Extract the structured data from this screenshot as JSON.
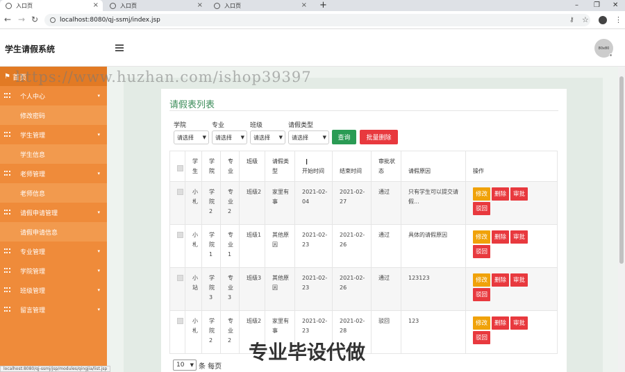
{
  "browser": {
    "tabs": [
      {
        "title": "入口页"
      },
      {
        "title": "入口页"
      },
      {
        "title": "入口页"
      }
    ],
    "url": "localhost:8080/qj-ssmj/index.jsp",
    "status_url": "localhost:8080/qj-ssmj/jsp/modules/qingjia/list.jsp"
  },
  "header": {
    "app_title": "学生请假系统",
    "avatar_text": "80x80"
  },
  "sidebar": {
    "top_label": "首页",
    "items": [
      {
        "type": "group",
        "label": "个人中心"
      },
      {
        "type": "sub",
        "label": "修改密码"
      },
      {
        "type": "group",
        "label": "学生管理"
      },
      {
        "type": "sub",
        "label": "学生信息"
      },
      {
        "type": "group",
        "label": "老师管理"
      },
      {
        "type": "sub",
        "label": "老师信息"
      },
      {
        "type": "group",
        "label": "请假申请管理"
      },
      {
        "type": "sub",
        "label": "请假申请信息"
      },
      {
        "type": "group",
        "label": "专业管理"
      },
      {
        "type": "group",
        "label": "学院管理"
      },
      {
        "type": "group",
        "label": "班级管理"
      },
      {
        "type": "group",
        "label": "留言管理"
      }
    ]
  },
  "main": {
    "title": "请假表列表",
    "filters": [
      {
        "label": "学院",
        "value": "请选择"
      },
      {
        "label": "专业",
        "value": "请选择"
      },
      {
        "label": "班级",
        "value": "请选择"
      },
      {
        "label": "请假类型",
        "value": "请选择"
      }
    ],
    "query_label": "查询",
    "batch_delete_label": "批量删除",
    "columns": [
      "学生",
      "学院",
      "专业",
      "班级",
      "请假类型",
      "开始时间",
      "结束时间",
      "审批状态",
      "请假原因",
      "操作"
    ],
    "rows": [
      {
        "student": "小札",
        "college": "学院2",
        "major": "专业2",
        "class": "班级2",
        "type": "家里有事",
        "start": "2021-02-04",
        "end": "2021-02-27",
        "status": "通过",
        "reason": "只有学生可以提交请假..."
      },
      {
        "student": "小札",
        "college": "学院1",
        "major": "专业1",
        "class": "班级1",
        "type": "其他原因",
        "start": "2021-02-23",
        "end": "2021-02-26",
        "status": "通过",
        "reason": "具体的请假原因"
      },
      {
        "student": "小站",
        "college": "学院3",
        "major": "专业3",
        "class": "班级3",
        "type": "其他原因",
        "start": "2021-02-23",
        "end": "2021-02-26",
        "status": "通过",
        "reason": "123123"
      },
      {
        "student": "小札",
        "college": "学院2",
        "major": "专业2",
        "class": "班级2",
        "type": "家里有事",
        "start": "2021-02-23",
        "end": "2021-02-28",
        "status": "驳回",
        "reason": "123"
      }
    ],
    "ops": {
      "edit": "修改",
      "delete": "删除",
      "approve": "审批",
      "reject": "驳回"
    },
    "pager": {
      "page_size": "10",
      "suffix": "条 每页"
    }
  },
  "watermark": "https://www.huzhan.com/ishop39397",
  "overlay_text": "专业毕设代做",
  "colors": {
    "sidebar": "#ef8b3a",
    "primary_green": "#2a9b54",
    "danger_red": "#e8393e",
    "warning_orange": "#f0a20a"
  }
}
